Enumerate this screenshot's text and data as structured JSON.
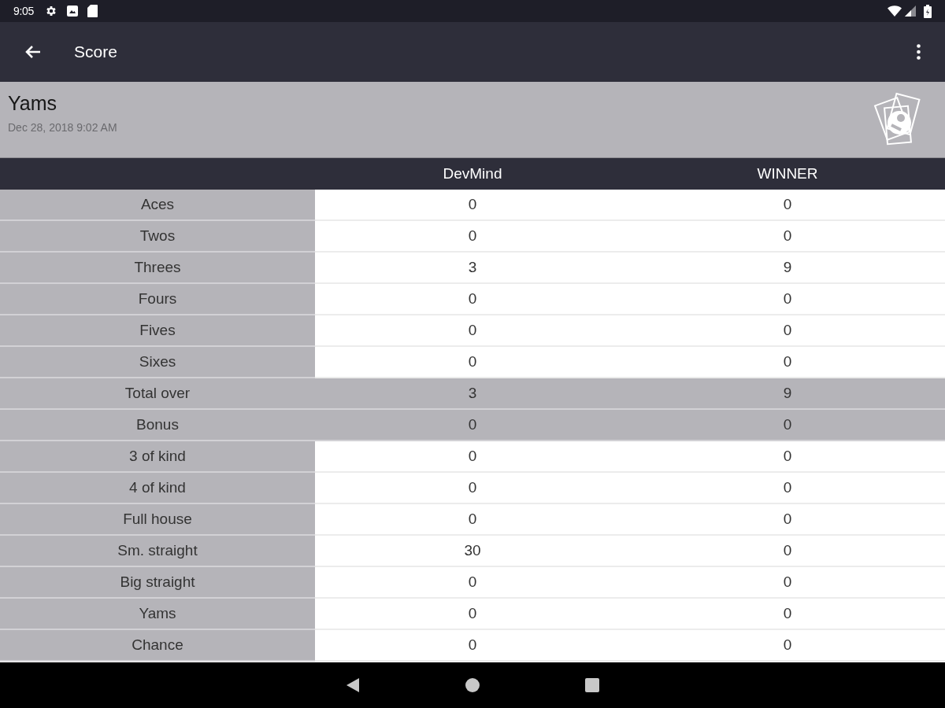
{
  "status_bar": {
    "time": "9:05"
  },
  "app_bar": {
    "title": "Score"
  },
  "game": {
    "name": "Yams",
    "date": "Dec 28, 2018 9:02 AM"
  },
  "table": {
    "columns": [
      "DevMind",
      "WINNER"
    ],
    "rows": [
      {
        "label": "Aces",
        "values": [
          "0",
          "0"
        ],
        "highlighted": false
      },
      {
        "label": "Twos",
        "values": [
          "0",
          "0"
        ],
        "highlighted": false
      },
      {
        "label": "Threes",
        "values": [
          "3",
          "9"
        ],
        "highlighted": false
      },
      {
        "label": "Fours",
        "values": [
          "0",
          "0"
        ],
        "highlighted": false
      },
      {
        "label": "Fives",
        "values": [
          "0",
          "0"
        ],
        "highlighted": false
      },
      {
        "label": "Sixes",
        "values": [
          "0",
          "0"
        ],
        "highlighted": false
      },
      {
        "label": "Total over",
        "values": [
          "3",
          "9"
        ],
        "highlighted": true
      },
      {
        "label": "Bonus",
        "values": [
          "0",
          "0"
        ],
        "highlighted": true
      },
      {
        "label": "3 of kind",
        "values": [
          "0",
          "0"
        ],
        "highlighted": false
      },
      {
        "label": "4 of kind",
        "values": [
          "0",
          "0"
        ],
        "highlighted": false
      },
      {
        "label": "Full house",
        "values": [
          "0",
          "0"
        ],
        "highlighted": false
      },
      {
        "label": "Sm. straight",
        "values": [
          "30",
          "0"
        ],
        "highlighted": false
      },
      {
        "label": "Big straight",
        "values": [
          "0",
          "0"
        ],
        "highlighted": false
      },
      {
        "label": "Yams",
        "values": [
          "0",
          "0"
        ],
        "highlighted": false
      },
      {
        "label": "Chance",
        "values": [
          "0",
          "0"
        ],
        "highlighted": false
      }
    ]
  }
}
